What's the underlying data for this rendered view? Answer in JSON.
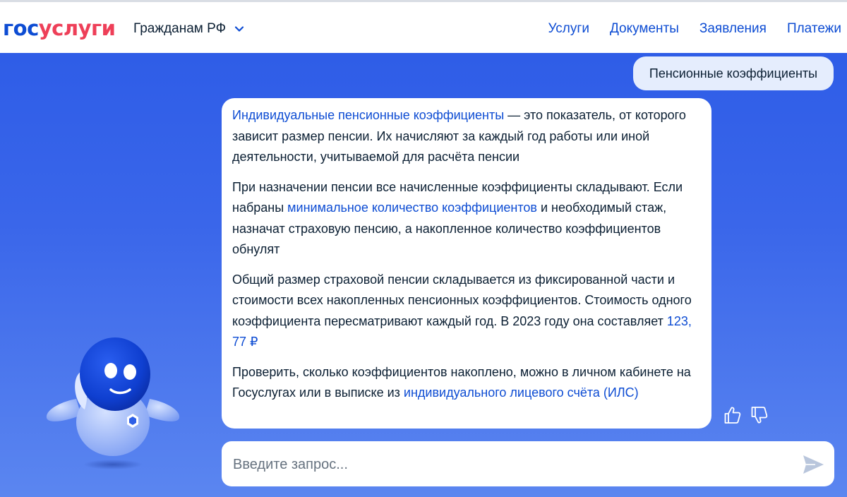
{
  "header": {
    "logo_part1": "гос",
    "logo_part2": "услуги",
    "region_label": "Гражданам РФ",
    "nav": [
      "Услуги",
      "Документы",
      "Заявления",
      "Платежи"
    ]
  },
  "chat": {
    "user_message": "Пенсионные коэффициенты",
    "bot": {
      "p1_link": "Индивидуальные пенсионные коэффициенты",
      "p1_text": " — это показатель, от которого зависит размер пенсии. Их начисляют за каждый год работы или иной деятельности, учитываемой для расчёта пенсии",
      "p2_text_a": "При назначении пенсии все начисленные коэффициенты складывают. Если набраны ",
      "p2_link": "минимальное количество коэффициентов",
      "p2_text_b": " и необходимый стаж, назначат страховую пенсию, а накопленное количество коэффициентов обнулят",
      "p3_text": "Общий размер страховой пенсии складывается из фиксированной части и стоимости всех накопленных пенсионных коэффициентов. Стоимость одного коэффициента пересматривают каждый год. В 2023 году она составляет ",
      "p3_link": "123, 77 ₽",
      "p4_text": "Проверить, сколько коэффициентов накоплено, можно в личном кабинете на Госуслугах или в выписке из ",
      "p4_link": "индивидуального лицевого счёта (ИЛС)"
    }
  },
  "input": {
    "placeholder": "Введите запрос..."
  },
  "colors": {
    "brand_blue": "#0d4cd3",
    "brand_red": "#ee3f58",
    "background_blue": "#2b5ae6"
  }
}
